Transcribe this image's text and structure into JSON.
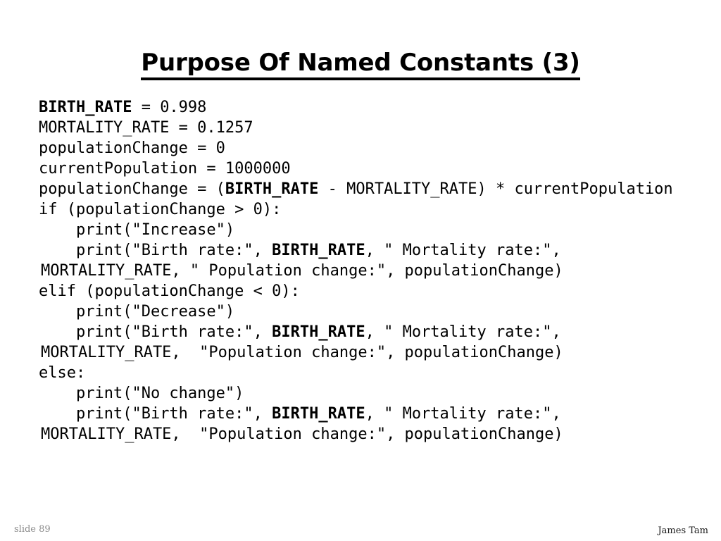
{
  "slide": {
    "title": "Purpose Of Named Constants (3)",
    "background_color": "#ffffff",
    "text_color": "#000000"
  },
  "code": {
    "language": "python",
    "lines": [
      {
        "id": "line-1",
        "indent": 0,
        "continuation": false,
        "segments": [
          {
            "text": "BIRTH_RATE",
            "bold": true
          },
          {
            "text": " = 0.998",
            "bold": false
          }
        ]
      },
      {
        "id": "line-2",
        "indent": 0,
        "continuation": false,
        "segments": [
          {
            "text": "MORTALITY_RATE = 0.1257",
            "bold": false
          }
        ]
      },
      {
        "id": "line-3",
        "indent": 0,
        "continuation": false,
        "segments": [
          {
            "text": "populationChange = 0",
            "bold": false
          }
        ]
      },
      {
        "id": "line-4",
        "indent": 0,
        "continuation": false,
        "segments": [
          {
            "text": "currentPopulation = 1000000",
            "bold": false
          }
        ]
      },
      {
        "id": "line-5",
        "indent": 0,
        "continuation": false,
        "segments": [
          {
            "text": "populationChange = (",
            "bold": false
          },
          {
            "text": "BIRTH_RATE",
            "bold": true
          },
          {
            "text": " - MORTALITY_RATE) * currentPopulation",
            "bold": false
          }
        ]
      },
      {
        "id": "line-6",
        "indent": 0,
        "continuation": false,
        "segments": [
          {
            "text": "if (populationChange > 0):",
            "bold": false
          }
        ]
      },
      {
        "id": "line-7",
        "indent": 4,
        "continuation": false,
        "segments": [
          {
            "text": "print(\"Increase\")",
            "bold": false
          }
        ]
      },
      {
        "id": "line-8",
        "indent": 4,
        "continuation": false,
        "segments": [
          {
            "text": "print(\"Birth rate:\", ",
            "bold": false
          },
          {
            "text": "BIRTH_RATE",
            "bold": true
          },
          {
            "text": ", \" Mortality rate:\",",
            "bold": false
          }
        ]
      },
      {
        "id": "line-9",
        "indent": 0,
        "continuation": true,
        "segments": [
          {
            "text": "MORTALITY_RATE, \" Population change:\", populationChange)",
            "bold": false
          }
        ]
      },
      {
        "id": "line-10",
        "indent": 0,
        "continuation": false,
        "segments": [
          {
            "text": "elif (populationChange < 0):",
            "bold": false
          }
        ]
      },
      {
        "id": "line-11",
        "indent": 4,
        "continuation": false,
        "segments": [
          {
            "text": "print(\"Decrease\")",
            "bold": false
          }
        ]
      },
      {
        "id": "line-12",
        "indent": 4,
        "continuation": false,
        "segments": [
          {
            "text": "print(\"Birth rate:\", ",
            "bold": false
          },
          {
            "text": "BIRTH_RATE",
            "bold": true
          },
          {
            "text": ", \" Mortality rate:\",",
            "bold": false
          }
        ]
      },
      {
        "id": "line-13",
        "indent": 0,
        "continuation": true,
        "segments": [
          {
            "text": "MORTALITY_RATE,  \"Population change:\", populationChange)",
            "bold": false
          }
        ]
      },
      {
        "id": "line-14",
        "indent": 0,
        "continuation": false,
        "segments": [
          {
            "text": "else:",
            "bold": false
          }
        ]
      },
      {
        "id": "line-15",
        "indent": 4,
        "continuation": false,
        "segments": [
          {
            "text": "print(\"No change\")",
            "bold": false
          }
        ]
      },
      {
        "id": "line-16",
        "indent": 4,
        "continuation": false,
        "segments": [
          {
            "text": "print(\"Birth rate:\", ",
            "bold": false
          },
          {
            "text": "BIRTH_RATE",
            "bold": true
          },
          {
            "text": ", \" Mortality rate:\",",
            "bold": false
          }
        ]
      },
      {
        "id": "line-17",
        "indent": 0,
        "continuation": true,
        "segments": [
          {
            "text": "MORTALITY_RATE,  \"Population change:\", populationChange)",
            "bold": false
          }
        ]
      }
    ]
  },
  "footer": {
    "slide_number_label": "slide 89",
    "author": "James Tam"
  }
}
